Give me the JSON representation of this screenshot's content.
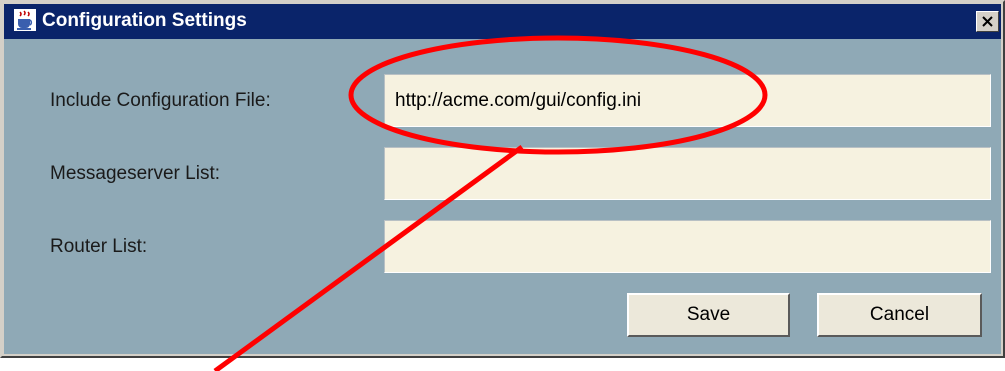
{
  "window": {
    "title": "Configuration Settings",
    "title_bar_color": "#0a246a",
    "panel_color": "#8fa9b6",
    "app_icon": "java-coffee-cup-icon",
    "close_icon": "close-icon"
  },
  "form": {
    "include_config_label": "Include Configuration File:",
    "include_config_value": "http://acme.com/gui/config.ini",
    "messageserver_label": "Messageserver List:",
    "messageserver_value": "",
    "router_label": "Router List:",
    "router_value": ""
  },
  "buttons": {
    "save": "Save",
    "cancel": "Cancel"
  },
  "annotation": {
    "color": "#ff0000",
    "shape": "ellipse-with-pointer-line"
  }
}
